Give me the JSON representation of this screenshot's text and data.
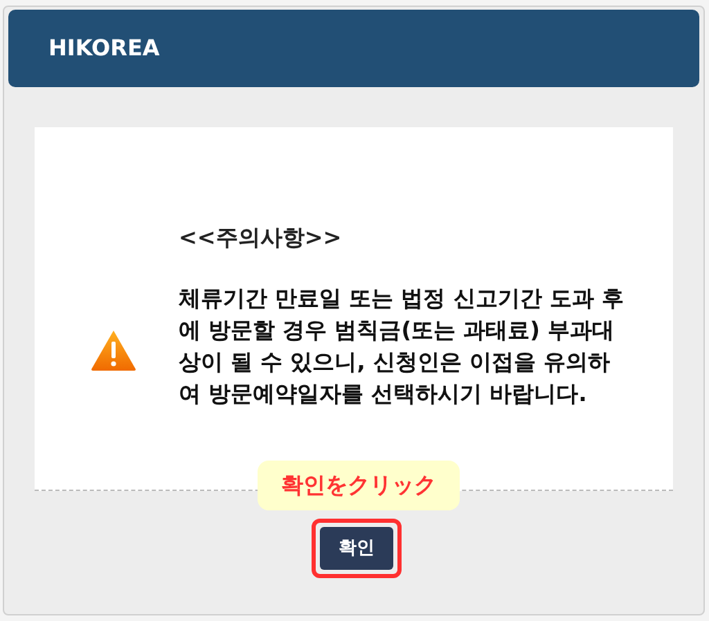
{
  "dialog": {
    "title": "HIKOREA",
    "heading": "<<주의사항>>",
    "message": "체류기간 만료일 또는 법정 신고기간 도과 후에 방문할 경우 범칙금(또는 과태료) 부과대상이 될 수 있으니, 신청인은 이접을 유의하여 방문예약일자를 선택하시기 바랍니다.",
    "button": "확인"
  },
  "callout": {
    "text": "확인をクリック"
  }
}
